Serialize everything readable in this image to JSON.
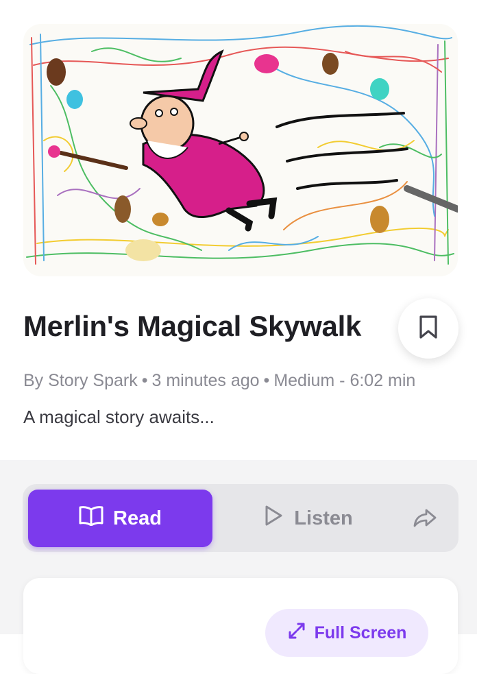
{
  "story": {
    "title": "Merlin's Magical Skywalk",
    "author": "By Story Spark",
    "posted": "3 minutes ago",
    "length": "Medium - 6:02 min",
    "description": "A magical story awaits..."
  },
  "modes": {
    "read_label": "Read",
    "listen_label": "Listen"
  },
  "reader": {
    "fullscreen_label": "Full Screen"
  },
  "icons": {
    "bookmark": "bookmark-icon",
    "read": "open-book-icon",
    "listen": "play-icon",
    "share": "share-icon",
    "fullscreen": "expand-icon"
  },
  "colors": {
    "accent": "#7c3aed",
    "accent_light": "#f0e9fe",
    "muted_text": "#8a8a93"
  }
}
